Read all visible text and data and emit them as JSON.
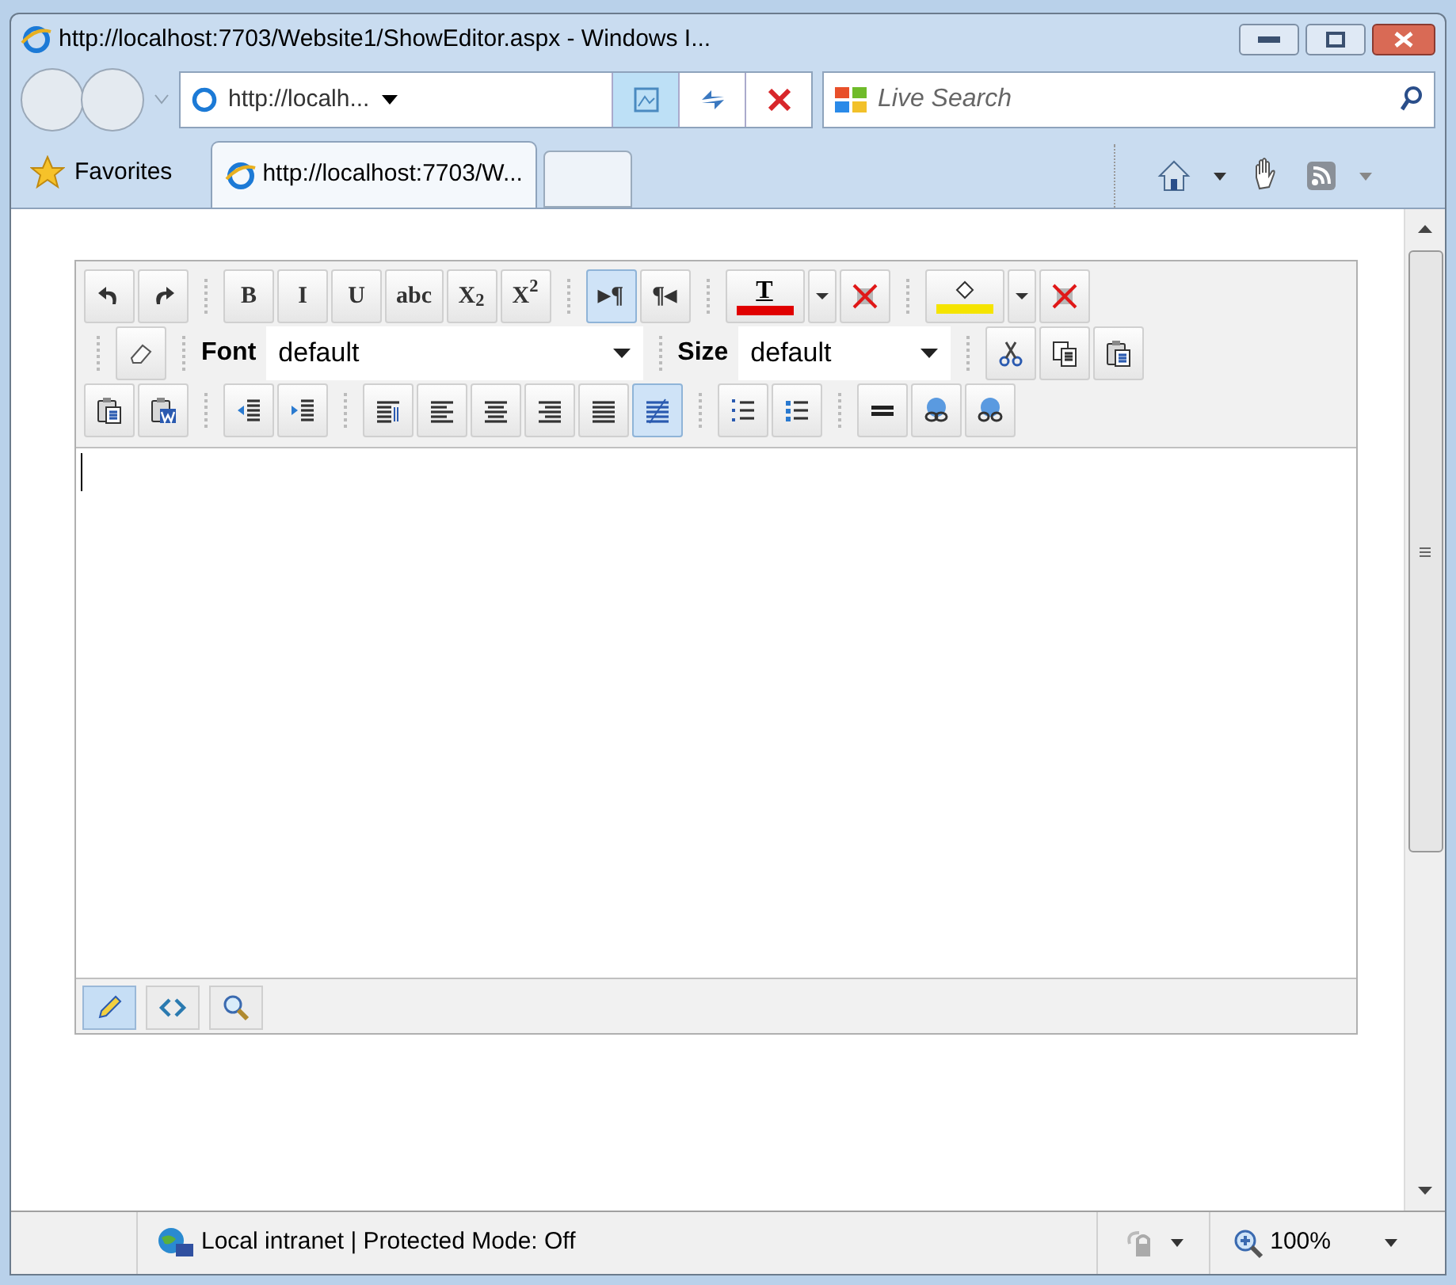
{
  "window": {
    "title": "http://localhost:7703/Website1/ShowEditor.aspx - Windows I..."
  },
  "address_bar": {
    "value": "http://localh..."
  },
  "search": {
    "placeholder": "Live Search"
  },
  "favorites": {
    "label": "Favorites"
  },
  "tabs": [
    {
      "label": "http://localhost:7703/W...",
      "selected": true
    }
  ],
  "editor": {
    "toolbar_rows": [
      [
        {
          "kind": "icon",
          "selected": false
        },
        {
          "kind": "icon",
          "selected": false
        },
        {
          "kind": "sep"
        },
        {
          "kind": "text",
          "label": "B",
          "selected": false
        },
        {
          "kind": "text",
          "label": "I",
          "selected": false
        },
        {
          "kind": "text",
          "label": "U",
          "selected": false
        },
        {
          "kind": "text",
          "label": "abc",
          "selected": false
        },
        {
          "kind": "text",
          "label": "X$_{2}$",
          "selected": false
        },
        {
          "kind": "text",
          "label": "X$^{2}$",
          "selected": false
        },
        {
          "kind": "sep"
        },
        {
          "kind": "text",
          "label": "▸¶",
          "selected": true
        },
        {
          "kind": "text",
          "label": "¶◂",
          "selected": false
        },
        {
          "kind": "sep"
        },
        {
          "kind": "color",
          "label": "T",
          "color": "#e00000",
          "selected": false
        },
        {
          "kind": "dropdown",
          "selected": false
        },
        {
          "kind": "icon",
          "selected": false
        },
        {
          "kind": "sep"
        },
        {
          "kind": "color",
          "color": "#f5e400",
          "selected": false
        },
        {
          "kind": "dropdown",
          "selected": false
        },
        {
          "kind": "icon",
          "selected": false
        }
      ],
      [
        {
          "kind": "sep"
        },
        {
          "kind": "icon",
          "selected": false
        },
        {
          "kind": "sep"
        },
        {
          "kind": "select",
          "label": "Font",
          "value": "default"
        },
        {
          "kind": "sep"
        },
        {
          "kind": "select",
          "label": "Size",
          "value": "default"
        },
        {
          "kind": "sep"
        },
        {
          "kind": "icon",
          "selected": false
        },
        {
          "kind": "icon",
          "selected": false
        },
        {
          "kind": "icon",
          "selected": false
        }
      ],
      [
        {
          "kind": "icon",
          "selected": false
        },
        {
          "kind": "icon",
          "selected": false
        },
        {
          "kind": "sep"
        },
        {
          "kind": "icon",
          "selected": false
        },
        {
          "kind": "icon",
          "selected": false
        },
        {
          "kind": "sep"
        },
        {
          "kind": "icon",
          "selected": false
        },
        {
          "kind": "icon",
          "selected": false
        },
        {
          "kind": "icon",
          "selected": false
        },
        {
          "kind": "icon",
          "selected": false
        },
        {
          "kind": "icon",
          "selected": false
        },
        {
          "kind": "icon",
          "selected": true
        },
        {
          "kind": "sep"
        },
        {
          "kind": "icon",
          "selected": false
        },
        {
          "kind": "icon",
          "selected": false
        },
        {
          "kind": "sep"
        },
        {
          "kind": "icon",
          "selected": false
        },
        {
          "kind": "icon",
          "selected": false
        },
        {
          "kind": "icon",
          "selected": false
        }
      ]
    ],
    "modes": [
      {
        "selected": true
      },
      {
        "selected": false
      },
      {
        "selected": false
      }
    ]
  },
  "status_bar": {
    "zone": "Local intranet | Protected Mode: Off",
    "zoom": "100%"
  }
}
